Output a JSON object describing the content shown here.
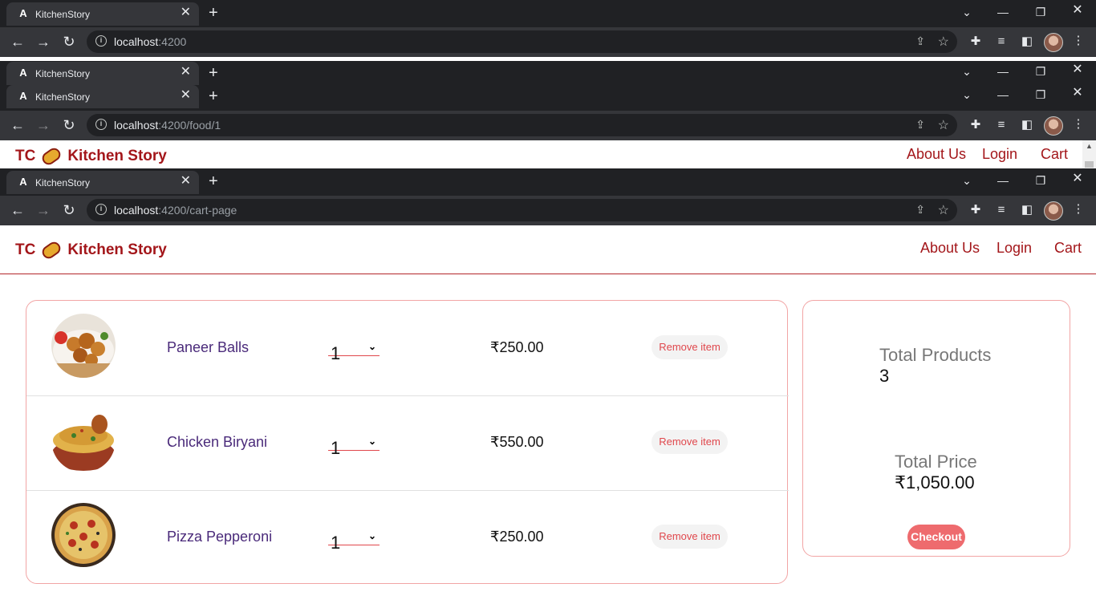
{
  "tab_title": "KitchenStory",
  "window1": {
    "host": "localhost",
    "path": ":4200"
  },
  "window2": {
    "host": "localhost",
    "path": ":4200/food/1"
  },
  "window3": {
    "host": "localhost",
    "path": ":4200/cart-page"
  },
  "brand": {
    "prefix": "TC",
    "name": "Kitchen Story"
  },
  "nav": {
    "about": "About Us",
    "login": "Login",
    "cart": "Cart"
  },
  "cart": {
    "items": [
      {
        "name": "Paneer Balls",
        "qty": "1",
        "price": "₹250.00",
        "remove": "Remove item",
        "image": "paneer-balls-image"
      },
      {
        "name": "Chicken Biryani",
        "qty": "1",
        "price": "₹550.00",
        "remove": "Remove item",
        "image": "chicken-biryani-image"
      },
      {
        "name": "Pizza Pepperoni",
        "qty": "1",
        "price": "₹250.00",
        "remove": "Remove item",
        "image": "pizza-pepperoni-image"
      }
    ]
  },
  "summary": {
    "total_products_label": "Total Products",
    "total_products_value": "3",
    "total_price_label": "Total Price",
    "total_price_value": "₹1,050.00",
    "checkout": "Checkout"
  },
  "colors": {
    "brand": "#a3161a",
    "accent": "#ee6b6e",
    "item_name": "#4a2a7a"
  }
}
